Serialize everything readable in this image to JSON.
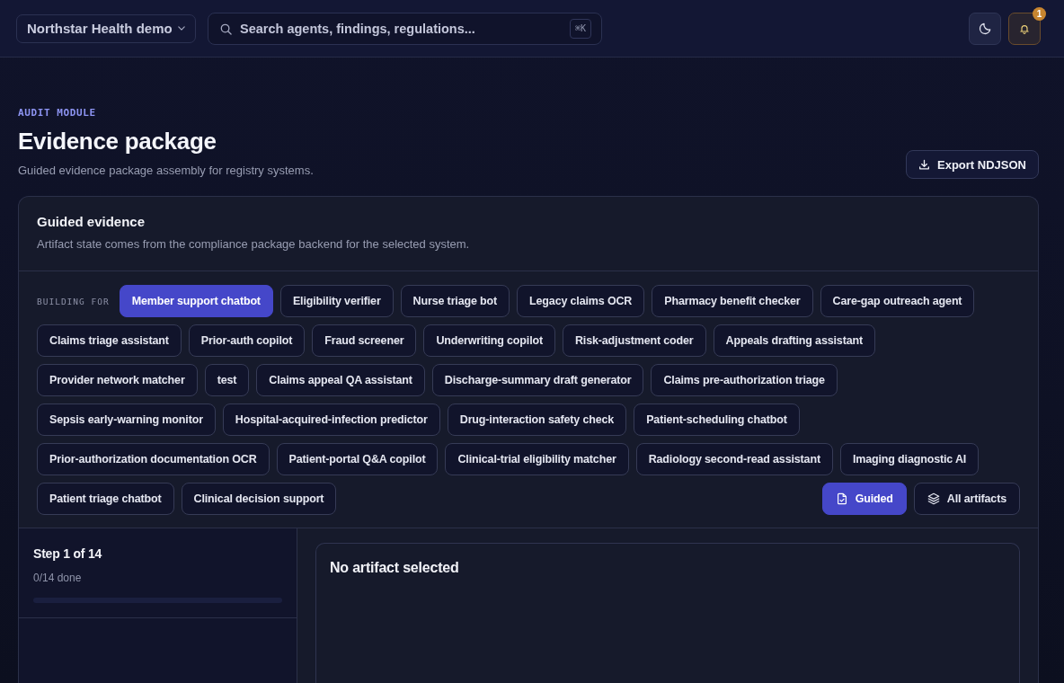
{
  "top_bar": {
    "workspace": "Northstar Health demo",
    "search": {
      "placeholder": "Search agents, findings, regulations...",
      "shortcut": "⌘K"
    },
    "notifications": {
      "badge": "1"
    }
  },
  "header": {
    "eyebrow": "AUDIT MODULE",
    "title": "Evidence package",
    "subtitle": "Guided evidence package assembly for registry systems.",
    "export_button": "Export NDJSON"
  },
  "card": {
    "title": "Guided evidence",
    "description": "Artifact state comes from the compliance package backend for the selected system.",
    "building_for_label": "BUILDING FOR",
    "systems": [
      {
        "label": "Member support chatbot",
        "selected": true
      },
      {
        "label": "Eligibility verifier",
        "selected": false
      },
      {
        "label": "Nurse triage bot",
        "selected": false
      },
      {
        "label": "Legacy claims OCR",
        "selected": false
      },
      {
        "label": "Pharmacy benefit checker",
        "selected": false
      },
      {
        "label": "Care-gap outreach agent",
        "selected": false
      },
      {
        "label": "Claims triage assistant",
        "selected": false
      },
      {
        "label": "Prior-auth copilot",
        "selected": false
      },
      {
        "label": "Fraud screener",
        "selected": false
      },
      {
        "label": "Underwriting copilot",
        "selected": false
      },
      {
        "label": "Risk-adjustment coder",
        "selected": false
      },
      {
        "label": "Appeals drafting assistant",
        "selected": false
      },
      {
        "label": "Provider network matcher",
        "selected": false
      },
      {
        "label": "test",
        "selected": false
      },
      {
        "label": "Claims appeal QA assistant",
        "selected": false
      },
      {
        "label": "Discharge-summary draft generator",
        "selected": false
      },
      {
        "label": "Claims pre-authorization triage",
        "selected": false
      },
      {
        "label": "Sepsis early-warning monitor",
        "selected": false
      },
      {
        "label": "Hospital-acquired-infection predictor",
        "selected": false
      },
      {
        "label": "Drug-interaction safety check",
        "selected": false
      },
      {
        "label": "Patient-scheduling chatbot",
        "selected": false
      },
      {
        "label": "Prior-authorization documentation OCR",
        "selected": false
      },
      {
        "label": "Patient-portal Q&A copilot",
        "selected": false
      },
      {
        "label": "Clinical-trial eligibility matcher",
        "selected": false
      },
      {
        "label": "Radiology second-read assistant",
        "selected": false
      },
      {
        "label": "Imaging diagnostic AI",
        "selected": false
      },
      {
        "label": "Patient triage chatbot",
        "selected": false
      },
      {
        "label": "Clinical decision support",
        "selected": false
      }
    ],
    "view_modes": [
      {
        "kind": "guided",
        "label": "Guided",
        "selected": true
      },
      {
        "kind": "all",
        "label": "All artifacts",
        "selected": false
      }
    ],
    "progress": {
      "title": "Step 1 of 14",
      "done_text": "0/14 done",
      "level": 0
    },
    "detail": {
      "title": "No artifact selected"
    }
  }
}
